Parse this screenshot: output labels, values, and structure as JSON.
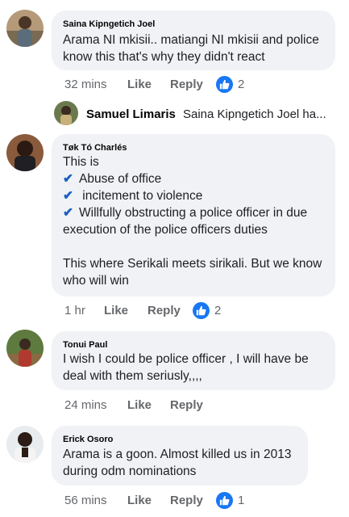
{
  "comments": [
    {
      "author": "Saina Kipngetich Joel",
      "lines": [
        "Arama NI mkisii.. matiangi NI mkisii and police",
        "know this that's why they didn't react"
      ],
      "time": "32 mins",
      "like": "Like",
      "reply": "Reply",
      "reactions": "2"
    },
    {
      "author": "Tøk Tó Charlés",
      "lines": [
        "This is",
        "Abuse of office",
        " incitement to violence",
        "Willfully obstructing a police officer in due",
        "execution of the police officers duties",
        "",
        "This where Serikali meets sirikali. But we know",
        "who will win"
      ],
      "time": "1 hr",
      "like": "Like",
      "reply": "Reply",
      "reactions": "2"
    },
    {
      "author": "Tonui Paul",
      "lines": [
        "I wish I could be police officer , I will  have  be",
        "deal with them seriusly,,,,"
      ],
      "time": "24 mins",
      "like": "Like",
      "reply": "Reply"
    },
    {
      "author": "Erick Osoro",
      "lines": [
        "Arama is a goon. Almost killed us in 2013",
        "during odm nominations"
      ],
      "time": "56 mins",
      "like": "Like",
      "reply": "Reply",
      "reactions": "1"
    }
  ],
  "reply_preview": {
    "author": "Samuel Limaris",
    "text": "Saina Kipngetich Joel ha..."
  },
  "icons": {
    "check": "✔",
    "like": "thumbs-up-icon"
  },
  "colors": {
    "bubble": "#f0f2f5",
    "meta": "#65676b",
    "like_badge": "#1877f2",
    "check": "#1b5fbf"
  }
}
